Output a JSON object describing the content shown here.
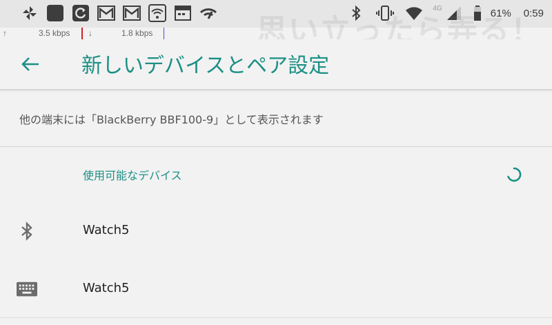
{
  "status_bar": {
    "left_icons": [
      "pinwheel-icon",
      "app-square-icon",
      "app-refresh-icon",
      "gmail-icon",
      "gmail-icon",
      "wifi-lock-icon",
      "calendar-icon",
      "signal-app-icon"
    ],
    "right_icons": [
      "bluetooth-icon",
      "vibrate-icon",
      "wifi-icon",
      "mobile-signal-icon",
      "battery-icon"
    ],
    "network_type": "4G",
    "battery": "61%",
    "time": "0:59"
  },
  "net_speed": {
    "upload": "3.5 kbps",
    "download": "1.8 kbps"
  },
  "watermark": "思い立ったら弄る！",
  "app_bar": {
    "back_icon": "arrow-back-icon",
    "title": "新しいデバイスとペア設定"
  },
  "info_text": "他の端末には「BlackBerry BBF100-9」として表示されます",
  "available_section": {
    "title": "使用可能なデバイス",
    "loading": true
  },
  "devices": [
    {
      "icon": "bluetooth-icon",
      "name": "Watch5"
    },
    {
      "icon": "keyboard-icon",
      "name": "Watch5"
    }
  ],
  "colors": {
    "accent": "#1c8f85",
    "background": "#f2f2f2",
    "status_bar": "#e6e6e6",
    "text_primary": "#212121",
    "text_secondary": "#555555"
  }
}
